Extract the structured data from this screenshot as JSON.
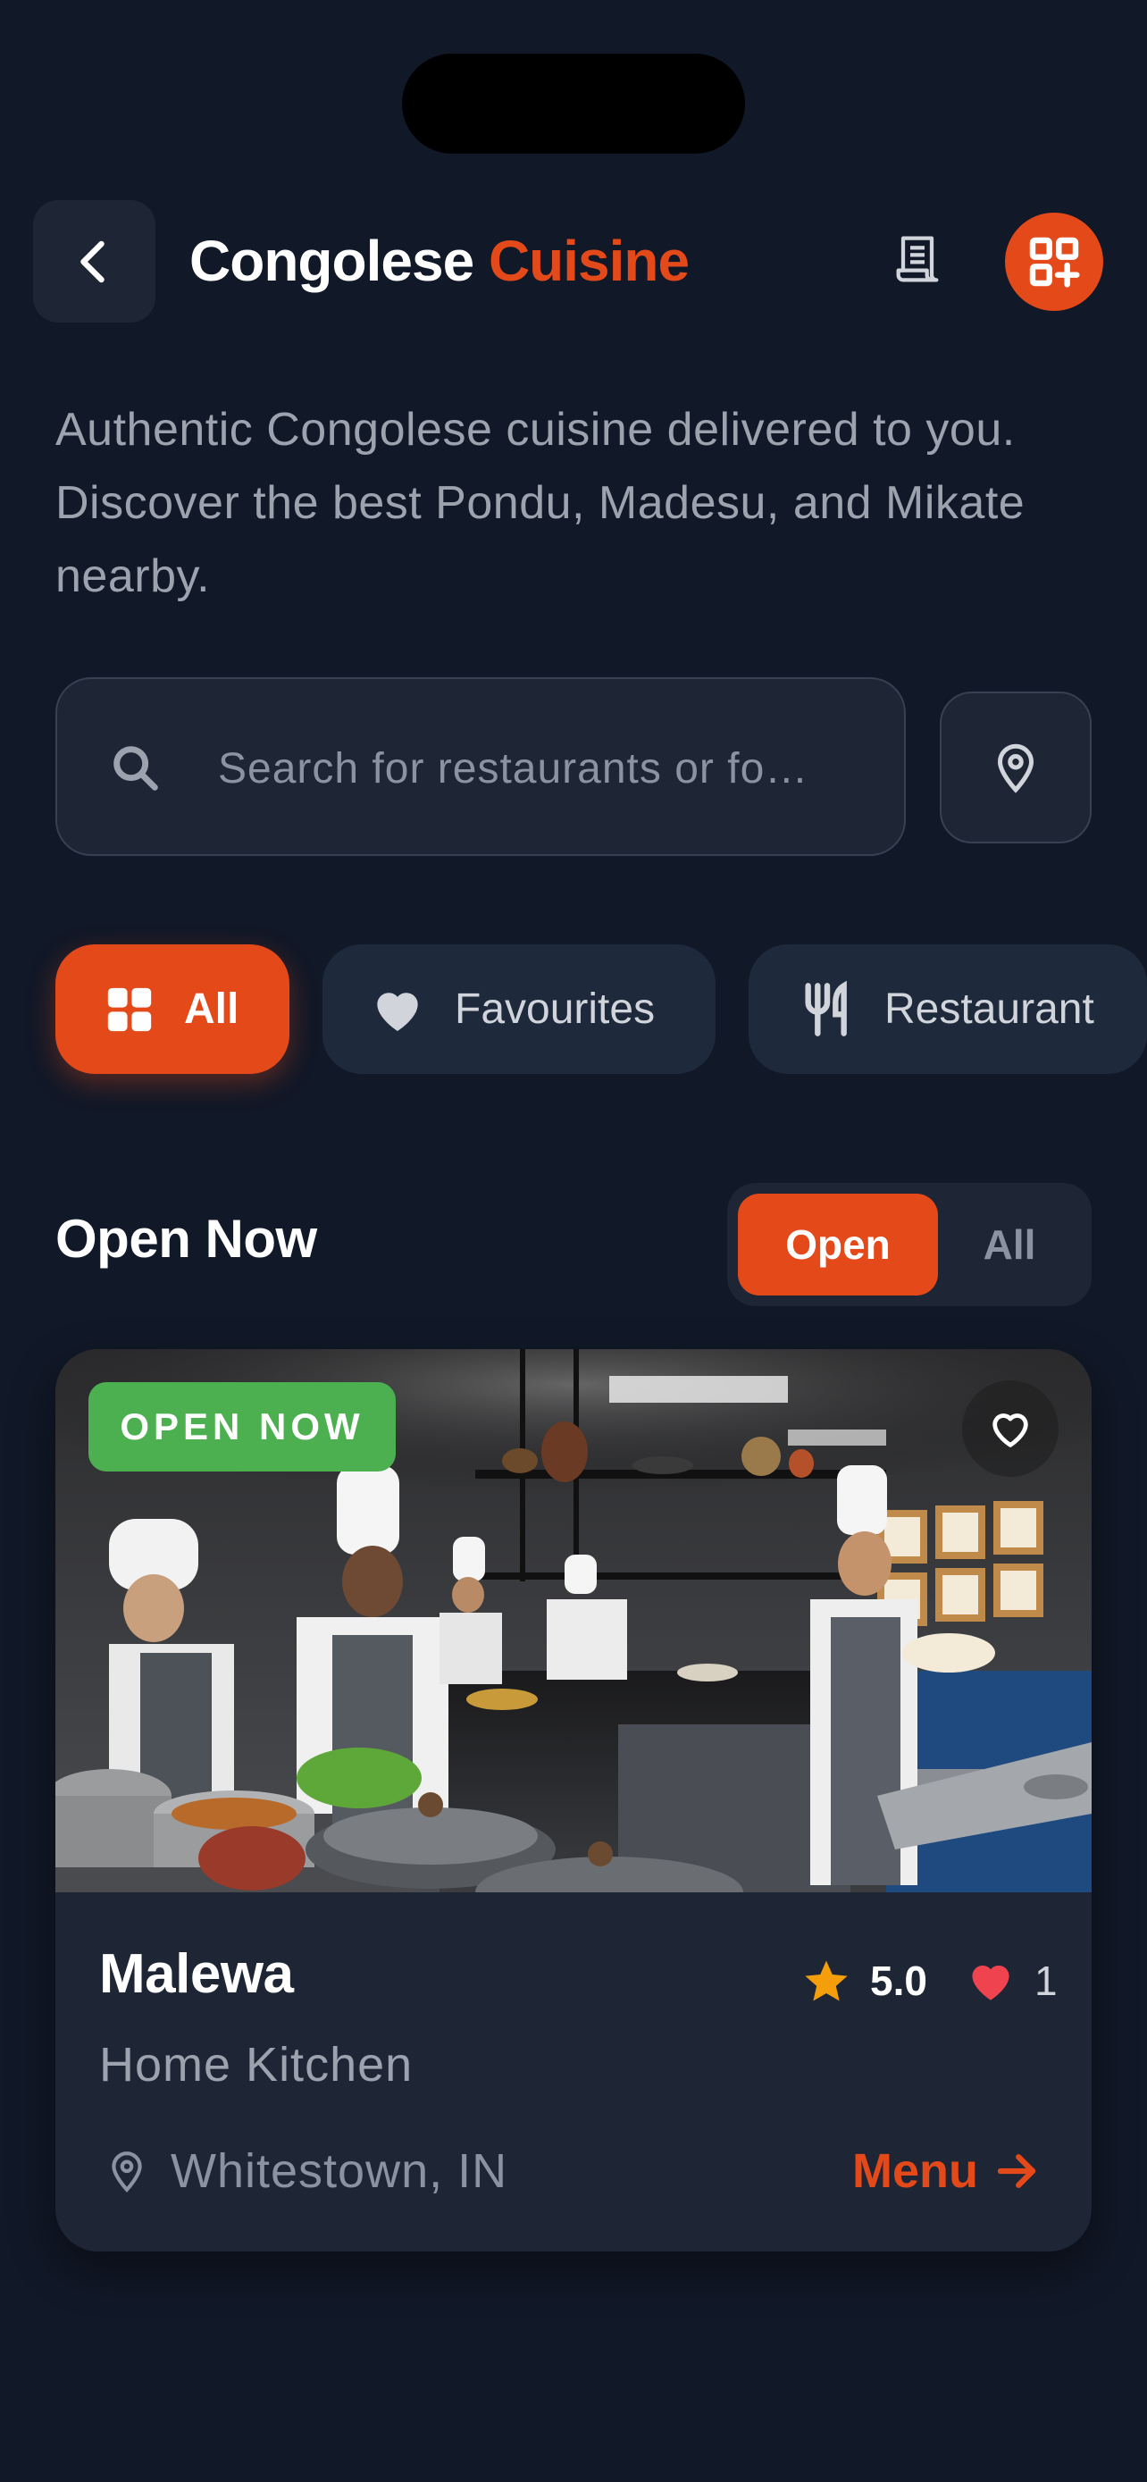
{
  "header": {
    "title_part1": "Congolese",
    "title_part2": "Cuisine",
    "back_icon": "chevron-left-icon",
    "receipt_icon": "receipt-icon",
    "grid_add_icon": "grid-add-icon"
  },
  "description": "Authentic Congolese cuisine delivered to you. Discover the best Pondu, Madesu, and Mikate nearby.",
  "search": {
    "placeholder": "Search for restaurants or fo…",
    "value": "",
    "icon": "search-icon",
    "location_icon": "map-pin-icon"
  },
  "filters": [
    {
      "label": "All",
      "icon": "grid-icon",
      "active": true
    },
    {
      "label": "Favourites",
      "icon": "heart-icon",
      "active": false
    },
    {
      "label": "Restaurant",
      "icon": "fork-knife-icon",
      "active": false
    }
  ],
  "section": {
    "title": "Open Now",
    "toggle": {
      "open_label": "Open",
      "all_label": "All",
      "selected": "Open"
    }
  },
  "card": {
    "badge": "OPEN NOW",
    "name": "Malewa",
    "rating": "5.0",
    "likes": "1",
    "type": "Home Kitchen",
    "location": "Whitestown, IN",
    "menu_label": "Menu",
    "image": "chefs-cooking-in-kitchen-photo"
  },
  "colors": {
    "background": "#111827",
    "surface": "#1e2636",
    "accent": "#e4491a",
    "badge_green": "#4cb050",
    "star": "#f59e0b",
    "heart": "#ef4450"
  }
}
